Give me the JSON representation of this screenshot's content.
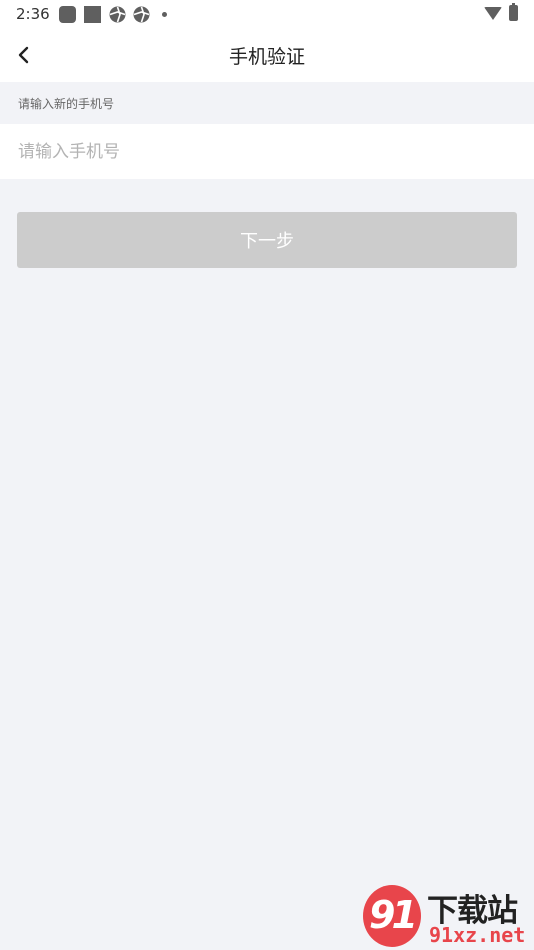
{
  "status_bar": {
    "time": "2:36"
  },
  "header": {
    "title": "手机验证"
  },
  "form": {
    "hint": "请输入新的手机号",
    "phone_value": "",
    "phone_placeholder": "请输入手机号",
    "next_label": "下一步"
  },
  "watermark": {
    "logo_text": "91",
    "title": "下载站",
    "url": "91xz.net"
  },
  "colors": {
    "page_background": "#f2f3f7",
    "button_disabled": "#cccccc",
    "watermark_red": "#e8454b"
  }
}
